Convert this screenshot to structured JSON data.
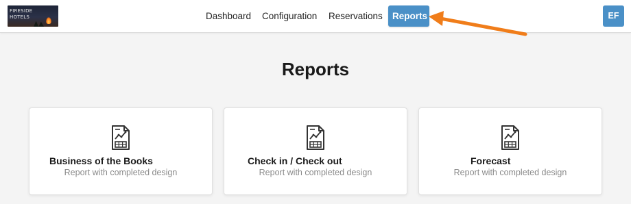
{
  "brand": {
    "logo_text_line1": "FIRESIDE",
    "logo_text_line2": "HOTELS"
  },
  "nav": {
    "items": [
      {
        "label": "Dashboard"
      },
      {
        "label": "Configuration"
      },
      {
        "label": "Reservations"
      },
      {
        "label": "Reports",
        "active": true
      }
    ]
  },
  "user": {
    "initials": "EF"
  },
  "page": {
    "title": "Reports"
  },
  "cards": [
    {
      "title": "Business of the Books",
      "description": "Report with completed design",
      "icon": "report-chart-icon"
    },
    {
      "title": "Check in / Check out",
      "description": "Report with completed design",
      "icon": "report-chart-icon"
    },
    {
      "title": "Forecast",
      "description": "Report with completed design",
      "icon": "report-chart-icon"
    }
  ],
  "colors": {
    "accent": "#4a90c7",
    "annotation_arrow": "#f07d1a",
    "background": "#f4f4f4"
  }
}
